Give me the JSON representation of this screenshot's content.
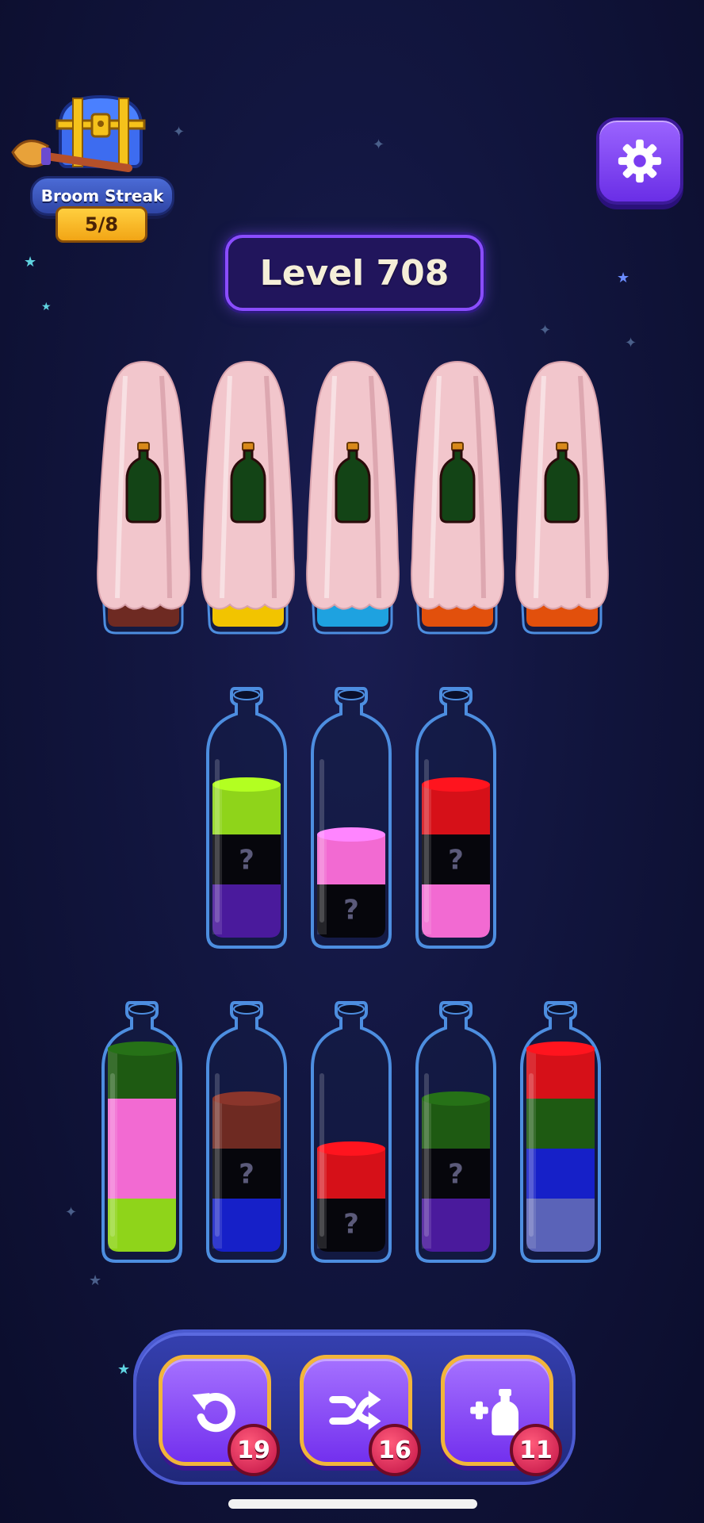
{
  "broom_streak": {
    "label": "Broom Streak",
    "progress": "5/8"
  },
  "level": {
    "title": "Level 708"
  },
  "settings": {
    "icon": "gear-icon"
  },
  "colors": {
    "lime": "#8fd41a",
    "purple": "#4a1a9c",
    "pink": "#f26ad2",
    "red": "#d61018",
    "green": "#1e5a12",
    "brown": "#6e2a22",
    "blue": "#1620c8",
    "periwinkle": "#5a63b8",
    "unknown": "#06060c",
    "yellow": "#f2c400",
    "cyan": "#1ea2e0",
    "orange": "#e2500c"
  },
  "hidden_label": "?",
  "covered_bottles": [
    {
      "base_color": "brown"
    },
    {
      "base_color": "yellow"
    },
    {
      "base_color": "cyan"
    },
    {
      "base_color": "orange"
    },
    {
      "base_color": "orange"
    }
  ],
  "bottles_row1": [
    {
      "layers": [
        "purple",
        "unknown",
        "lime"
      ]
    },
    {
      "layers": [
        "unknown",
        "pink"
      ]
    },
    {
      "layers": [
        "pink",
        "unknown",
        "red"
      ]
    }
  ],
  "bottles_row2": [
    {
      "layers": [
        "lime",
        "pink",
        "pink",
        "green"
      ]
    },
    {
      "layers": [
        "blue",
        "unknown",
        "brown"
      ]
    },
    {
      "layers": [
        "unknown",
        "red"
      ]
    },
    {
      "layers": [
        "purple",
        "unknown",
        "green"
      ]
    },
    {
      "layers": [
        "periwinkle",
        "blue",
        "green",
        "red"
      ]
    }
  ],
  "tools": [
    {
      "icon": "undo-icon",
      "count": "19"
    },
    {
      "icon": "shuffle-icon",
      "count": "16"
    },
    {
      "icon": "add-bottle-icon",
      "count": "11"
    }
  ]
}
